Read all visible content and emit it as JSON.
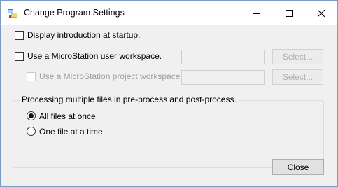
{
  "window": {
    "title": "Change Program Settings",
    "icon": "settings-app-icon",
    "controls": {
      "minimize_icon": "minimize-icon",
      "maximize_icon": "maximize-icon",
      "close_icon": "close-icon"
    }
  },
  "options": {
    "display_intro": {
      "label": "Display introduction at startup.",
      "checked": false
    },
    "user_workspace": {
      "label": "Use a MicroStation user workspace.",
      "checked": false,
      "value": "",
      "select_label": "Select...",
      "select_enabled": false
    },
    "project_workspace": {
      "label": "Use a MicroStation project workspace.",
      "checked": false,
      "enabled": false,
      "value": "",
      "select_label": "Select...",
      "select_enabled": false
    }
  },
  "processing": {
    "title": "Processing multiple files in pre-process and post-process.",
    "options": [
      {
        "label": "All files at once",
        "selected": true
      },
      {
        "label": "One file at a time",
        "selected": false
      }
    ]
  },
  "footer": {
    "close_label": "Close"
  },
  "colors": {
    "border": "#7a9cc4",
    "background": "#f0f0f0",
    "disabled_text": "#a0a0a0"
  }
}
